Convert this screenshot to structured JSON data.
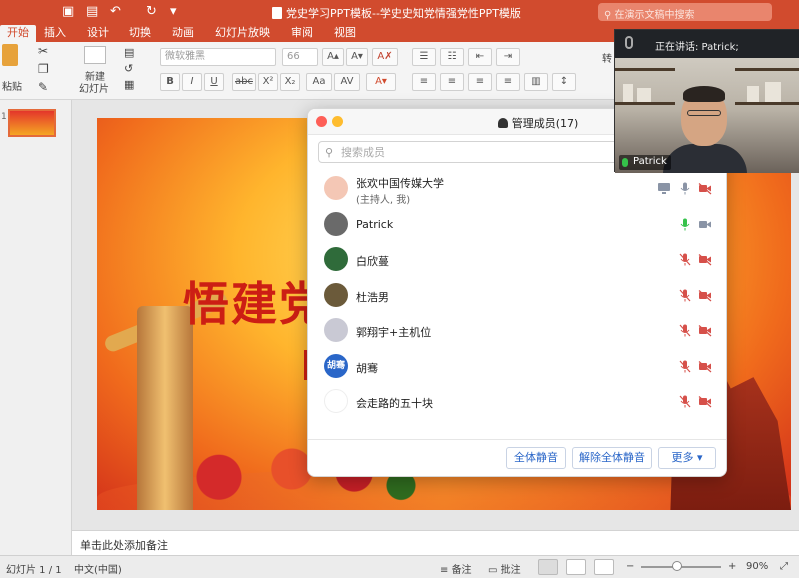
{
  "app": {
    "window_title": "党史学习PPT模板--学史史知党情强党性PPT模版",
    "search_placeholder": "在演示文稿中搜索",
    "tabs": [
      "开始",
      "插入",
      "设计",
      "切换",
      "动画",
      "幻灯片放映",
      "审阅",
      "视图"
    ],
    "active_tab": "开始"
  },
  "ribbon": {
    "paste": "粘贴",
    "new_slide_line1": "新建",
    "new_slide_line2": "幻灯片",
    "font_name": "微软雅黑",
    "font_size": "66",
    "bold": "B",
    "italic": "I",
    "underline": "U",
    "strike": "abc",
    "superscript": "X²",
    "subscript": "X₂",
    "convert_label": "转"
  },
  "slide": {
    "number": "1",
    "title_text": "悟建党",
    "notes_placeholder": "单击此处添加备注"
  },
  "status": {
    "slide_counter": "幻灯片 1 / 1",
    "language": "中文(中国)",
    "notes_btn": "备注",
    "comments_btn": "批注",
    "zoom_minus": "−",
    "zoom_plus": "+",
    "zoom_level": "90%"
  },
  "participants_panel": {
    "title": "管理成员(17)",
    "search_placeholder": "搜索成员",
    "members": [
      {
        "name": "张欢中国传媒大学",
        "role": "(主持人, 我)",
        "avatar_color": "#f4c7b5",
        "mic": "muted-gray",
        "cam": "off"
      },
      {
        "name": "Patrick",
        "role": "",
        "avatar_color": "#6a6a6a",
        "mic": "active",
        "cam": "on"
      },
      {
        "name": "白欣蔓",
        "role": "",
        "avatar_color": "#2f6b3a",
        "mic": "muted",
        "cam": "off"
      },
      {
        "name": "杜浩男",
        "role": "",
        "avatar_color": "#6b5a3a",
        "mic": "muted",
        "cam": "off"
      },
      {
        "name": "郭翔宇+主机位",
        "role": "",
        "avatar_color": "#c9c9d4",
        "mic": "muted",
        "cam": "off"
      },
      {
        "name": "胡骞",
        "role": "",
        "avatar_color": "#2a66c8",
        "avatar_text": "胡骞",
        "mic": "muted",
        "cam": "off"
      },
      {
        "name": "会走路的五十块",
        "role": "",
        "avatar_color": "#ffffff",
        "mic": "muted",
        "cam": "off"
      }
    ],
    "buttons": {
      "mute_all": "全体静音",
      "unmute_all": "解除全体静音",
      "more": "更多 ▾"
    },
    "colors": {
      "accent": "#2a66c8",
      "active_mic": "#35c24a",
      "muted": "#d6504a"
    }
  },
  "video": {
    "speaking_label": "正在讲话: Patrick;",
    "name_tag": "Patrick"
  },
  "colors": {
    "brand_red": "#d14b2e",
    "slide_title": "#cc1e14"
  }
}
